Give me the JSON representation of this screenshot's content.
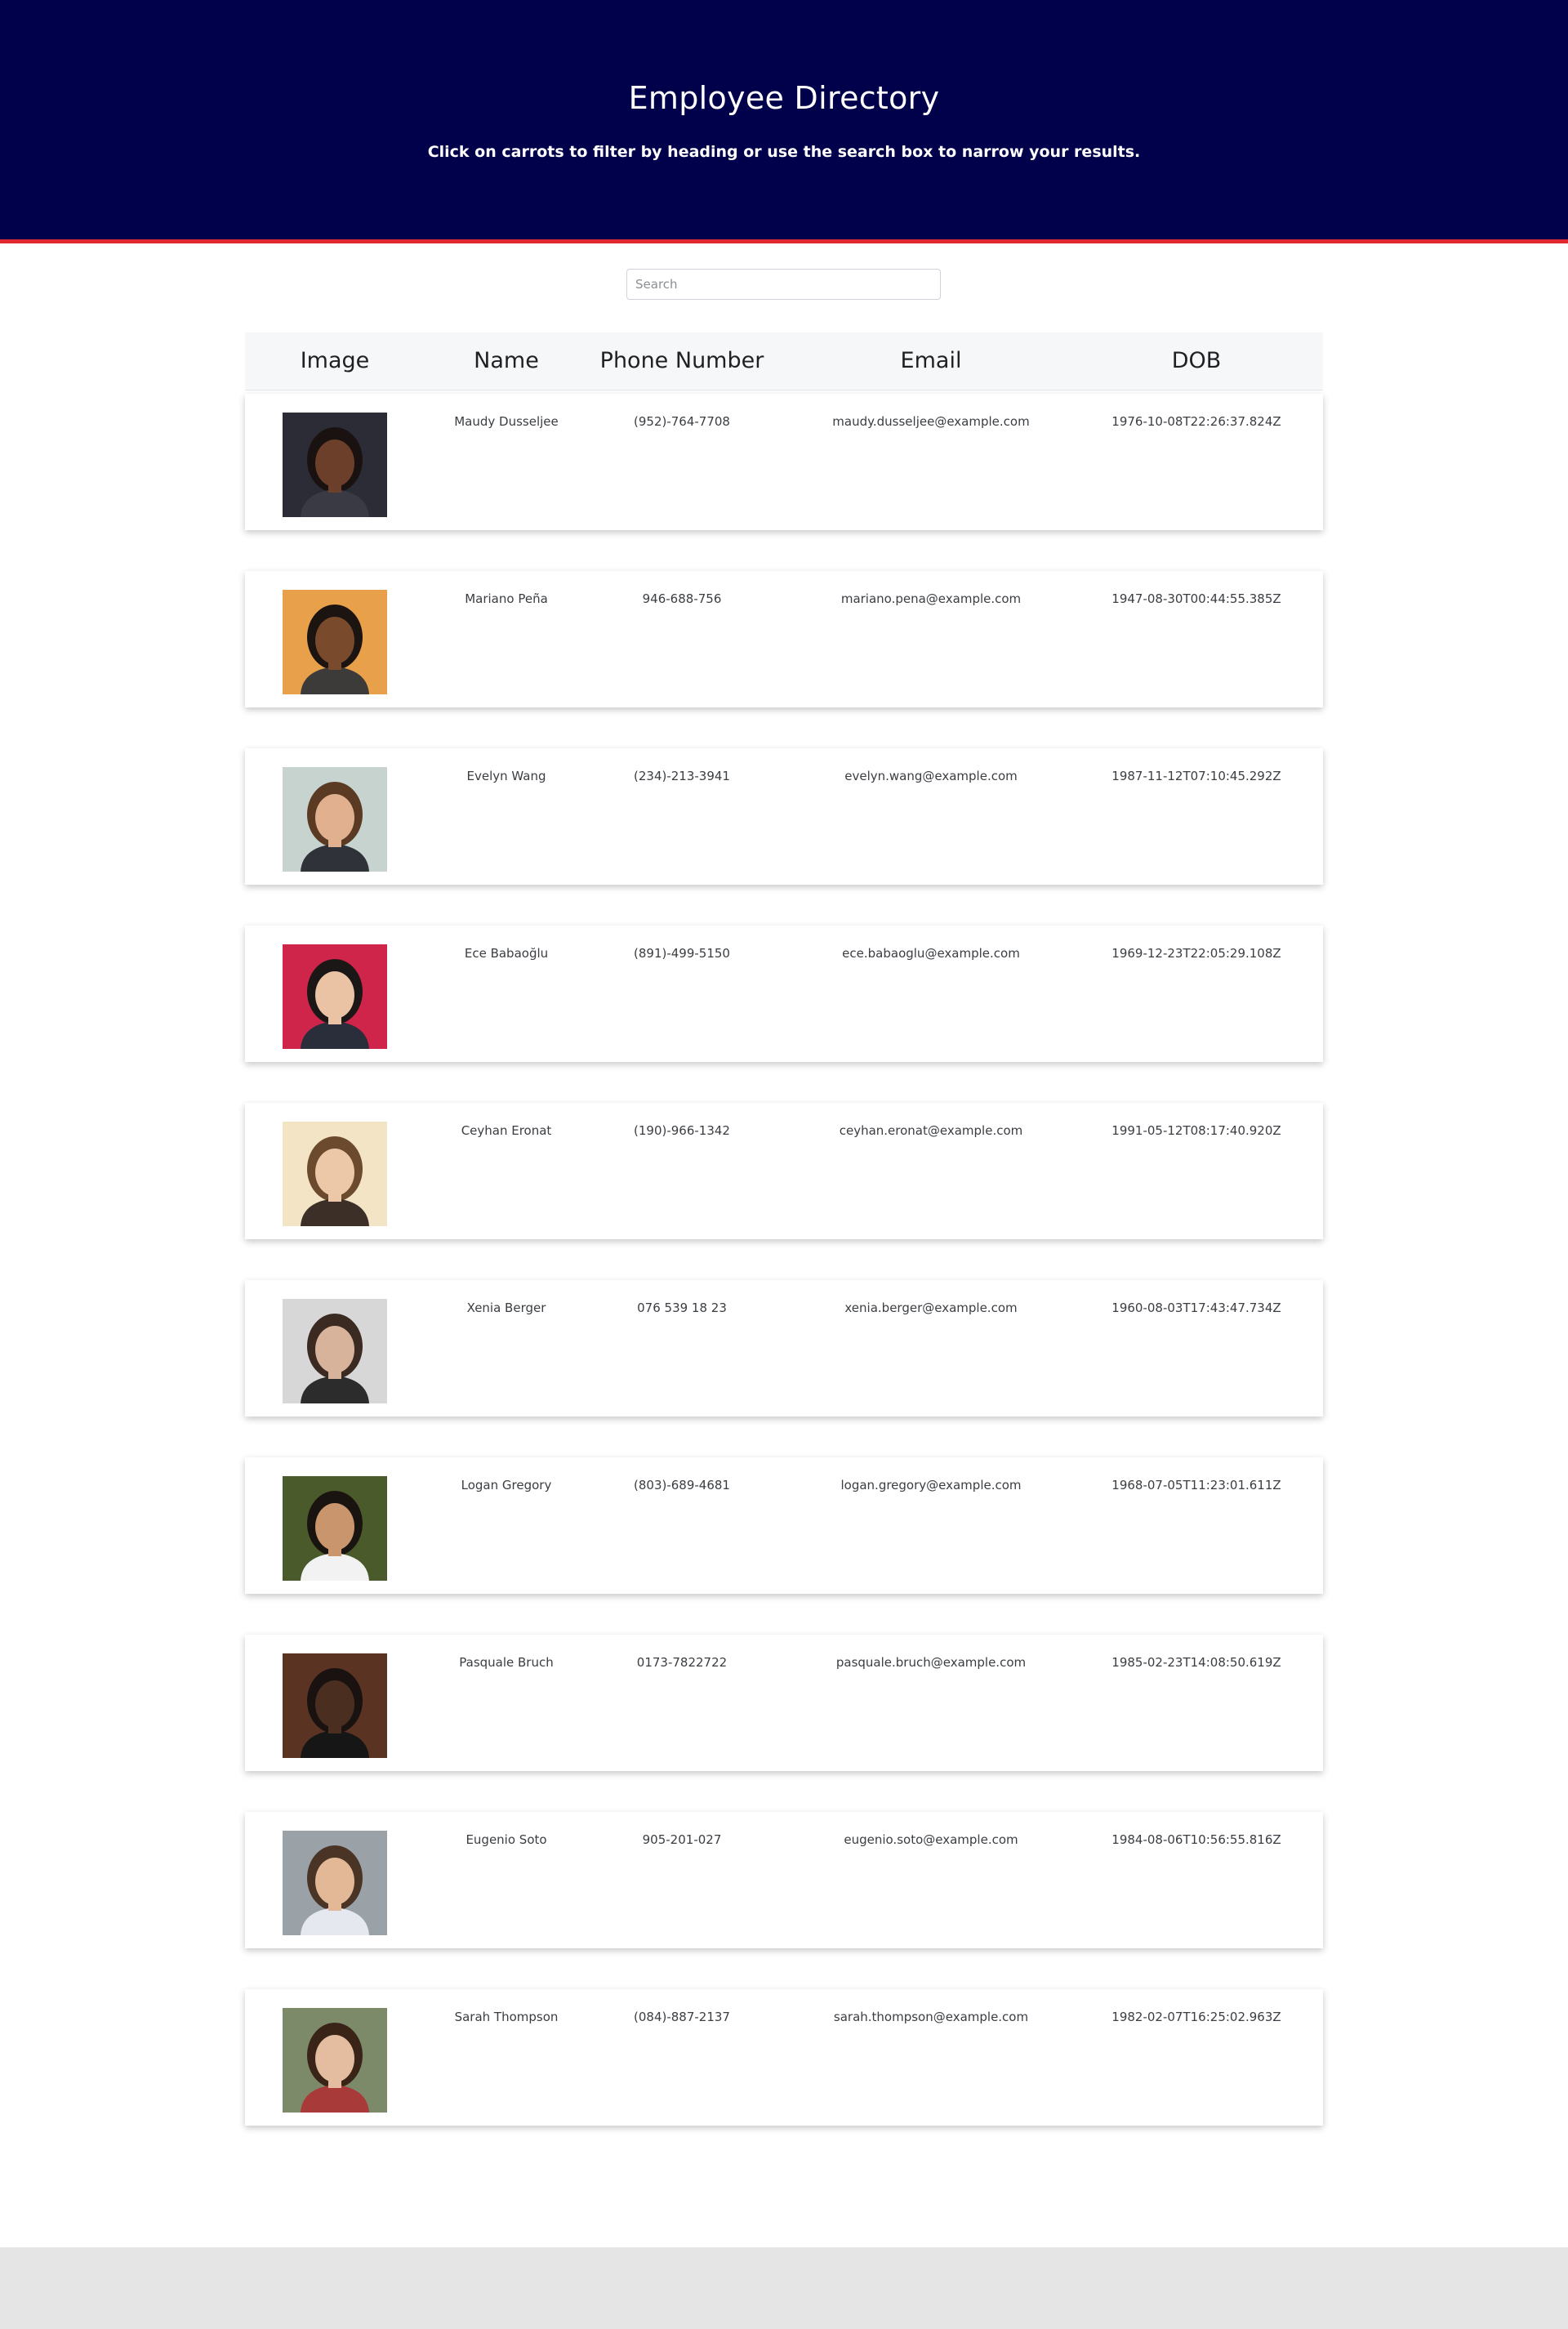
{
  "header": {
    "title": "Employee Directory",
    "subtitle": "Click on carrots to filter by heading or use the search box to narrow your results."
  },
  "search": {
    "placeholder": "Search",
    "value": ""
  },
  "table": {
    "columns": [
      "Image",
      "Name",
      "Phone Number",
      "Email",
      "DOB"
    ],
    "rows": [
      {
        "name": "Maudy Dusseljee",
        "phone": "(952)-764-7708",
        "email": "maudy.dusseljee@example.com",
        "dob": "1976-10-08T22:26:37.824Z",
        "bg": "#2c2c36",
        "skin": "#6b3f2a",
        "hair": "#1a1210",
        "shirt": "#3a3a44"
      },
      {
        "name": "Mariano Peña",
        "phone": "946-688-756",
        "email": "mariano.pena@example.com",
        "dob": "1947-08-30T00:44:55.385Z",
        "bg": "#e8a04a",
        "skin": "#7a4a2c",
        "hair": "#1c1410",
        "shirt": "#3d3b3a"
      },
      {
        "name": "Evelyn Wang",
        "phone": "(234)-213-3941",
        "email": "evelyn.wang@example.com",
        "dob": "1987-11-12T07:10:45.292Z",
        "bg": "#c7d3cf",
        "skin": "#e0b08f",
        "hair": "#5a3a22",
        "shirt": "#2f3238"
      },
      {
        "name": "Ece Babaoğlu",
        "phone": "(891)-499-5150",
        "email": "ece.babaoglu@example.com",
        "dob": "1969-12-23T22:05:29.108Z",
        "bg": "#d0254a",
        "skin": "#e9c3a4",
        "hair": "#1b1716",
        "shirt": "#2a2e3a"
      },
      {
        "name": "Ceyhan Eronat",
        "phone": "(190)-966-1342",
        "email": "ceyhan.eronat@example.com",
        "dob": "1991-05-12T08:17:40.920Z",
        "bg": "#f3e4c6",
        "skin": "#ecc7a8",
        "hair": "#6b4a2e",
        "shirt": "#3b2f28"
      },
      {
        "name": "Xenia Berger",
        "phone": "076 539 18 23",
        "email": "xenia.berger@example.com",
        "dob": "1960-08-03T17:43:47.734Z",
        "bg": "#d7d7d7",
        "skin": "#d7b39b",
        "hair": "#3a2a22",
        "shirt": "#2c2c2c"
      },
      {
        "name": "Logan Gregory",
        "phone": "(803)-689-4681",
        "email": "logan.gregory@example.com",
        "dob": "1968-07-05T11:23:01.611Z",
        "bg": "#4a5a2a",
        "skin": "#c9956c",
        "hair": "#1a1410",
        "shirt": "#f2f2f2"
      },
      {
        "name": "Pasquale Bruch",
        "phone": "0173-7822722",
        "email": "pasquale.bruch@example.com",
        "dob": "1985-02-23T14:08:50.619Z",
        "bg": "#5a3322",
        "skin": "#4a2e20",
        "hair": "#1a1210",
        "shirt": "#161616"
      },
      {
        "name": "Eugenio Soto",
        "phone": "905-201-027",
        "email": "eugenio.soto@example.com",
        "dob": "1984-08-06T10:56:55.816Z",
        "bg": "#9aa2a8",
        "skin": "#e2b896",
        "hair": "#4a3426",
        "shirt": "#e6e8f0"
      },
      {
        "name": "Sarah Thompson",
        "phone": "(084)-887-2137",
        "email": "sarah.thompson@example.com",
        "dob": "1982-02-07T16:25:02.963Z",
        "bg": "#7d8a6a",
        "skin": "#e4bda0",
        "hair": "#3a2418",
        "shirt": "#a83a3a"
      }
    ]
  }
}
